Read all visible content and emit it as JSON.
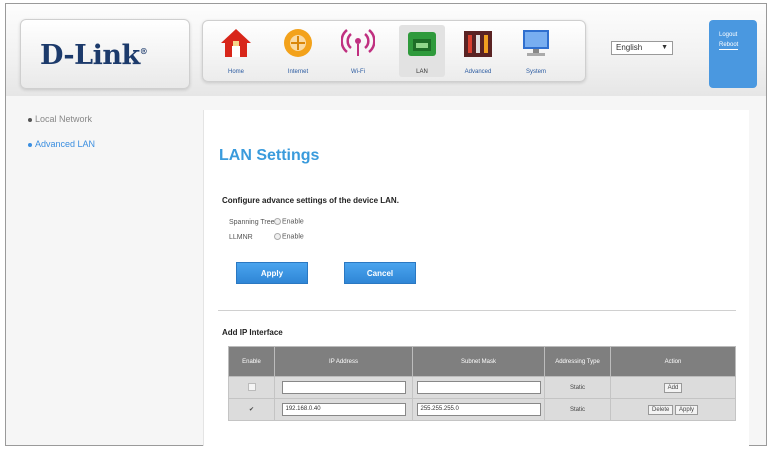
{
  "brand": {
    "logo": "D-Link"
  },
  "nav": [
    {
      "label": "Home",
      "icon": "house-icon"
    },
    {
      "label": "Internet",
      "icon": "globe-icon"
    },
    {
      "label": "Wi-Fi",
      "icon": "wifi-icon"
    },
    {
      "label": "LAN",
      "icon": "lan-icon"
    },
    {
      "label": "Advanced",
      "icon": "toolbox-icon"
    },
    {
      "label": "System",
      "icon": "monitor-icon"
    }
  ],
  "language": {
    "selected": "English"
  },
  "account": {
    "logout": "Logout",
    "reboot": "Reboot"
  },
  "sidebar": {
    "items": [
      {
        "label": "Local Network"
      },
      {
        "label": "Advanced LAN"
      }
    ]
  },
  "page": {
    "title": "LAN Settings",
    "section1": "Configure advance settings of the device LAN.",
    "spanning_label": "Spanning Tree",
    "spanning_opt": "Enable",
    "llmnr_label": "LLMNR",
    "llmnr_opt": "Enable",
    "apply": "Apply",
    "cancel": "Cancel",
    "section2": "Add IP Interface"
  },
  "table": {
    "headers": [
      "Enable",
      "IP Address",
      "Subnet Mask",
      "Addressing Type",
      "Action"
    ],
    "rows": [
      {
        "ip": "",
        "mask": "",
        "type": "Static",
        "actions": [
          "Add"
        ]
      },
      {
        "ip": "192.168.0.40",
        "mask": "255.255.255.0",
        "type": "Static",
        "actions": [
          "Delete",
          "Apply"
        ]
      }
    ]
  },
  "colors": {
    "accent": "#3a9bdc",
    "header_bar": "#7f7f7f",
    "logout_bg": "#4a98e0",
    "logo": "#1c3a6b"
  }
}
